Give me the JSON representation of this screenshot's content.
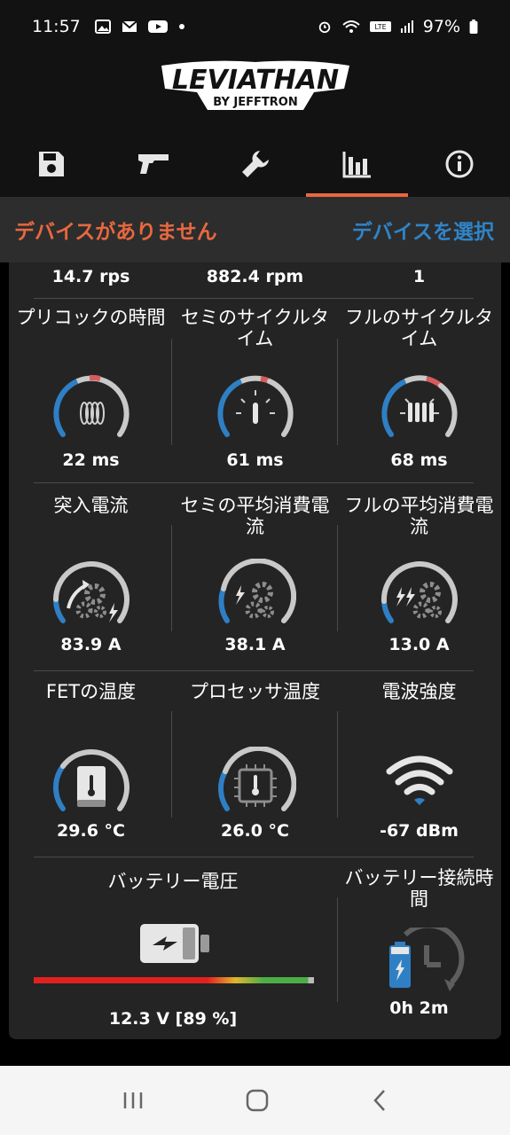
{
  "status": {
    "time": "11:57",
    "battery": "97%"
  },
  "tabs": [
    {
      "icon": "save-icon"
    },
    {
      "icon": "gun-icon"
    },
    {
      "icon": "wrench-icon"
    },
    {
      "icon": "bar-chart-icon",
      "active": true
    },
    {
      "icon": "info-icon"
    }
  ],
  "device": {
    "status": "デバイスがありません",
    "select_label": "デバイスを選択"
  },
  "top_values": [
    "14.7 rps",
    "882.4 rpm",
    "1"
  ],
  "metrics": {
    "precock": {
      "label": "プリコックの時間",
      "value": "22 ms"
    },
    "semi_cycle": {
      "label": "セミのサイクルタイム",
      "value": "61 ms"
    },
    "full_cycle": {
      "label": "フルのサイクルタイム",
      "value": "68 ms"
    },
    "inrush": {
      "label": "突入電流",
      "value": "83.9 A"
    },
    "semi_current": {
      "label": "セミの平均消費電流",
      "value": "38.1 A"
    },
    "full_current": {
      "label": "フルの平均消費電流",
      "value": "13.0 A"
    },
    "fet_temp": {
      "label": "FETの温度",
      "value": "29.6 °C"
    },
    "cpu_temp": {
      "label": "プロセッサ温度",
      "value": "26.0 °C"
    },
    "signal": {
      "label": "電波強度",
      "value": "-67 dBm"
    },
    "battery_voltage": {
      "label": "バッテリー電圧",
      "value": "12.3 V [89 %]"
    },
    "battery_time": {
      "label": "バッテリー接続時間",
      "value": "0h 2m"
    }
  },
  "colors": {
    "accent": "#e8683f",
    "link": "#2f84c8",
    "gauge_blue": "#2f7fc4",
    "gauge_grey": "#c9c9c9"
  },
  "logo": {
    "text": "LEVIATHAN",
    "sub": "BY JEFFTRON"
  }
}
